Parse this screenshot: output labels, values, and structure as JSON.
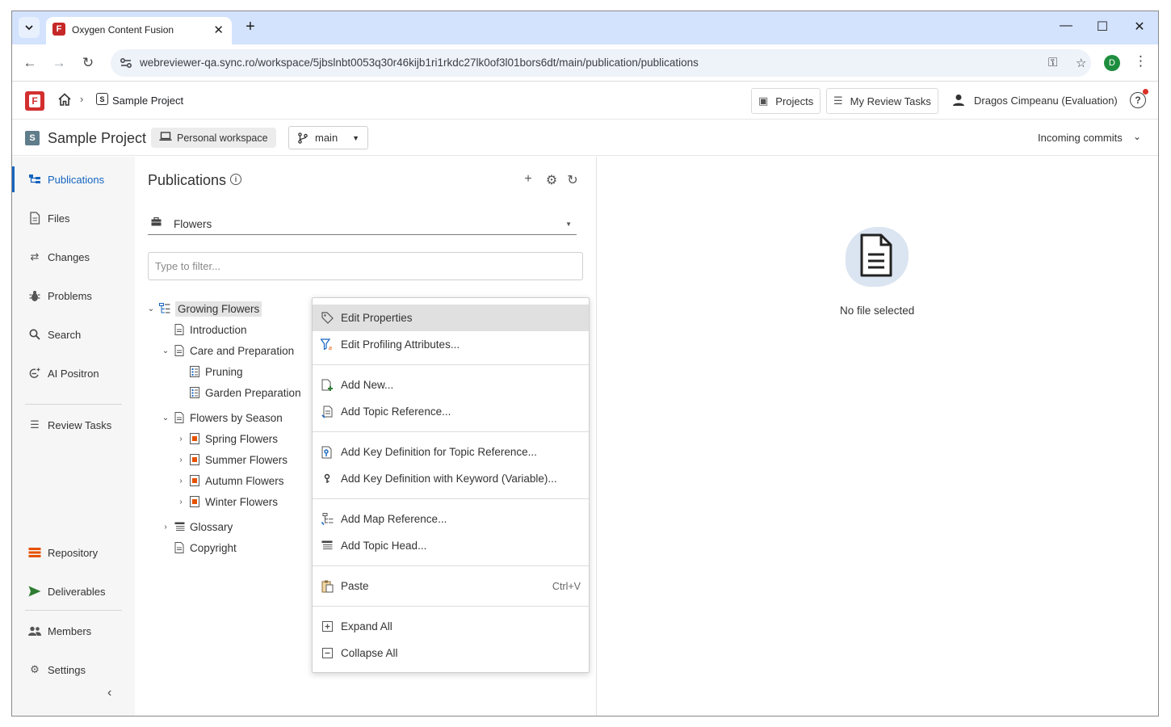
{
  "browser": {
    "tab_title": "Oxygen Content Fusion",
    "url": "webreviewer-qa.sync.ro/workspace/5jbslnbt0053q30r46kijb1ri1rkdc27lk0of3l01bors6dt/main/publication/publications",
    "profile_initial": "D",
    "favicon_letter": "F"
  },
  "header": {
    "logo_letter": "F",
    "breadcrumb_project_letter": "S",
    "breadcrumb_project": "Sample Project",
    "projects_label": "Projects",
    "review_tasks_label": "My Review Tasks",
    "user_name": "Dragos Cimpeanu  (Evaluation)"
  },
  "project_bar": {
    "badge": "S",
    "name": "Sample Project",
    "workspace": "Personal workspace",
    "branch": "main",
    "incoming": "Incoming commits"
  },
  "sidebar": {
    "items": [
      {
        "label": "Publications",
        "icon": "publications-icon"
      },
      {
        "label": "Files",
        "icon": "files-icon"
      },
      {
        "label": "Changes",
        "icon": "changes-icon"
      },
      {
        "label": "Problems",
        "icon": "bug-icon"
      },
      {
        "label": "Search",
        "icon": "search-icon"
      },
      {
        "label": "AI Positron",
        "icon": "ai-icon"
      },
      {
        "label": "Review Tasks",
        "icon": "list-icon"
      },
      {
        "label": "Repository",
        "icon": "repository-icon"
      },
      {
        "label": "Deliverables",
        "icon": "send-icon"
      },
      {
        "label": "Members",
        "icon": "members-icon"
      },
      {
        "label": "Settings",
        "icon": "gear-icon"
      }
    ],
    "accent": "#1565c0"
  },
  "publications": {
    "title": "Publications",
    "selected_publication": "Flowers",
    "filter_placeholder": "Type to filter...",
    "tree": [
      {
        "label": "Growing Flowers"
      },
      {
        "label": "Introduction"
      },
      {
        "label": "Care and Preparation"
      },
      {
        "label": "Pruning"
      },
      {
        "label": "Garden Preparation"
      },
      {
        "label": "Flowers by Season"
      },
      {
        "label": "Spring Flowers"
      },
      {
        "label": "Summer Flowers"
      },
      {
        "label": "Autumn Flowers"
      },
      {
        "label": "Winter Flowers"
      },
      {
        "label": "Glossary"
      },
      {
        "label": "Copyright"
      }
    ]
  },
  "preview": {
    "empty_text": "No file selected"
  },
  "context_menu": {
    "items": [
      {
        "label": "Edit Properties",
        "icon": "tag-icon"
      },
      {
        "label": "Edit Profiling Attributes...",
        "icon": "filter-icon"
      },
      {
        "label": "Add New...",
        "icon": "add-new-icon"
      },
      {
        "label": "Add Topic Reference...",
        "icon": "topic-ref-icon"
      },
      {
        "label": "Add Key Definition for Topic Reference...",
        "icon": "keydef-icon"
      },
      {
        "label": "Add Key Definition with Keyword (Variable)...",
        "icon": "key-icon"
      },
      {
        "label": "Add Map Reference...",
        "icon": "map-ref-icon"
      },
      {
        "label": "Add Topic Head...",
        "icon": "topic-head-icon"
      },
      {
        "label": "Paste",
        "icon": "paste-icon",
        "shortcut": "Ctrl+V"
      },
      {
        "label": "Expand All",
        "icon": "expand-icon"
      },
      {
        "label": "Collapse All",
        "icon": "collapse-icon"
      }
    ]
  }
}
